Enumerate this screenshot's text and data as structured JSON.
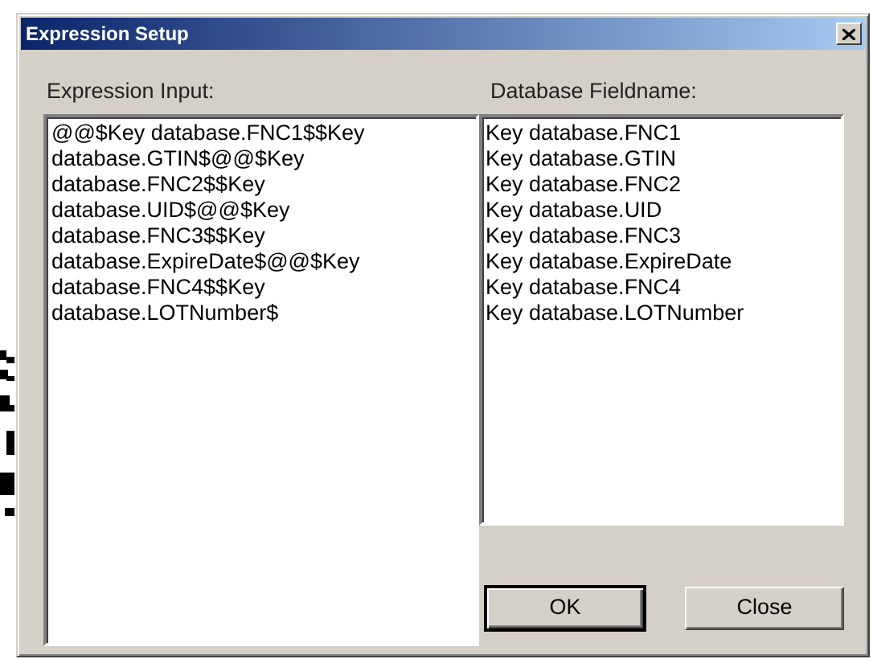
{
  "window": {
    "title": "Expression Setup"
  },
  "expression_input": {
    "label": "Expression Input:",
    "value": "@@$Key database.FNC1$$Key database.GTIN$@@$Key database.FNC2$$Key database.UID$@@$Key database.FNC3$$Key database.ExpireDate$@@$Key database.FNC4$$Key database.LOTNumber$"
  },
  "database_fieldname": {
    "label": "Database Fieldname:",
    "items": [
      "Key database.FNC1",
      "Key database.GTIN",
      "Key database.FNC2",
      "Key database.UID",
      "Key database.FNC3",
      "Key database.ExpireDate",
      "Key database.FNC4",
      "Key database.LOTNumber"
    ]
  },
  "buttons": [
    {
      "label": "OK",
      "default": true
    },
    {
      "label": "Close",
      "default": false
    }
  ]
}
